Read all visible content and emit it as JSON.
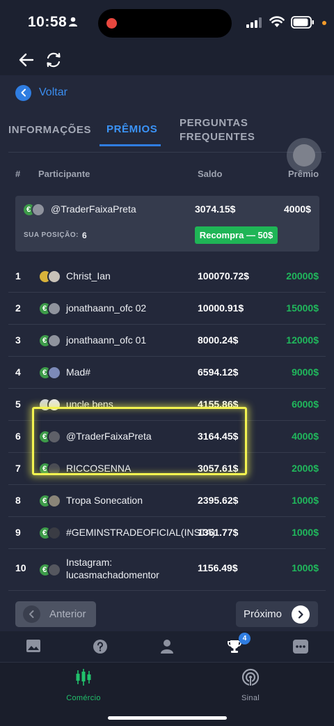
{
  "status_bar": {
    "time": "10:58"
  },
  "nav": {
    "back_label": "Voltar"
  },
  "tabs": [
    {
      "label": "INFORMAÇÕES",
      "active": false
    },
    {
      "label": "PRÊMIOS",
      "active": true
    },
    {
      "label": "PERGUNTAS FREQUENTES",
      "active": false
    }
  ],
  "table_header": {
    "rank": "#",
    "participant": "Participante",
    "balance": "Saldo",
    "prize": "Prêmio"
  },
  "my_entry": {
    "name": "@TraderFaixaPreta",
    "balance": "3074.15$",
    "prize": "4000$",
    "position_label": "SUA POSIÇÃO:",
    "position": "6",
    "rebuy_label": "Recompra — 50$"
  },
  "rows": [
    {
      "rank": "1",
      "name": "Christ_Ian",
      "balance": "100070.72$",
      "prize": "20000$"
    },
    {
      "rank": "2",
      "name": "jonathaann_ofc 02",
      "balance": "10000.91$",
      "prize": "15000$"
    },
    {
      "rank": "3",
      "name": "jonathaann_ofc 01",
      "balance": "8000.24$",
      "prize": "12000$"
    },
    {
      "rank": "4",
      "name": "Mad#",
      "balance": "6594.12$",
      "prize": "9000$"
    },
    {
      "rank": "5",
      "name": "uncle bens",
      "balance": "4155.86$",
      "prize": "6000$"
    },
    {
      "rank": "6",
      "name": "@TraderFaixaPreta",
      "balance": "3164.45$",
      "prize": "4000$"
    },
    {
      "rank": "7",
      "name": "RICCOSENNA",
      "balance": "3057.61$",
      "prize": "2000$"
    },
    {
      "rank": "8",
      "name": "Tropa Sonecation",
      "balance": "2395.62$",
      "prize": "1000$"
    },
    {
      "rank": "9",
      "name": "#GEMINSTRADEOFICIAL(INSTA)",
      "balance": "1351.77$",
      "prize": "1000$"
    },
    {
      "rank": "10",
      "name": "Instagram: lucasmachadomentor",
      "balance": "1156.49$",
      "prize": "1000$"
    }
  ],
  "pagination": {
    "prev_label": "Anterior",
    "next_label": "Próximo"
  },
  "icon_strip": {
    "trophy_badge": "4"
  },
  "bottom_nav": {
    "trade_label": "Comércio",
    "signal_label": "Sinal"
  },
  "colors": {
    "background": "#1c2130",
    "panel": "#23283a",
    "accent_blue": "#2f7de1",
    "prize_green": "#20b85c",
    "highlight_yellow": "#f3f350"
  }
}
